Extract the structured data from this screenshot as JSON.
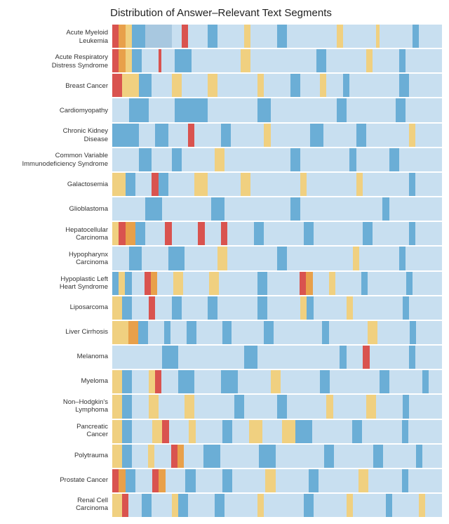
{
  "title": "Distribution of Answer–Relevant Text Segments",
  "labels": [
    "Acute Myeloid\nLeukemia",
    "Acute Respiratory\nDistress Syndrome",
    "Breast Cancer",
    "Cardiomyopathy",
    "Chronic Kidney\nDisease",
    "Common Variable\nImmunodeficiency Syndrome",
    "Galactosemia",
    "Glioblastoma",
    "Hepatocellular\nCarcinoma",
    "Hypopharynx\nCarcinoma",
    "Hypoplastic Left\nHeart Syndrome",
    "Liposarcoma",
    "Liver Cirrhosis",
    "Melanoma",
    "Myeloma",
    "Non–Hodgkin's\nLymphoma",
    "Pancreatic\nCancer",
    "Polytrauma",
    "Prostate Cancer",
    "Renal Cell\nCarcinoma"
  ],
  "colors": {
    "red": "#d9534f",
    "orange": "#e8a04a",
    "yellow": "#f0d080",
    "light_blue": "#a8c8e0",
    "blue": "#6baed6",
    "pale_blue": "#c8dff0"
  }
}
